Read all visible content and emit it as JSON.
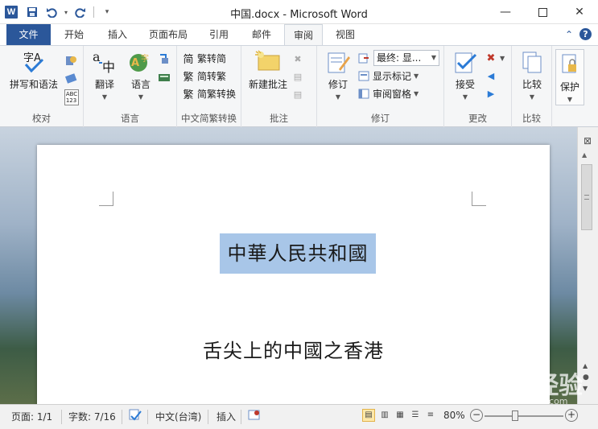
{
  "app": {
    "app_icon_letter": "W",
    "title": "中国.docx - Microsoft Word"
  },
  "qat": {
    "save_icon": "save-icon",
    "undo_icon": "undo-icon",
    "redo_icon": "redo-icon"
  },
  "tabs": [
    {
      "label": "文件"
    },
    {
      "label": "开始"
    },
    {
      "label": "插入"
    },
    {
      "label": "页面布局"
    },
    {
      "label": "引用"
    },
    {
      "label": "邮件"
    },
    {
      "label": "审阅"
    },
    {
      "label": "视图"
    }
  ],
  "active_tab": "审阅",
  "ribbon": {
    "groups": {
      "proofing": {
        "label": "校对",
        "spell": "拼写和语法"
      },
      "language": {
        "label": "语言",
        "translate": "翻译",
        "language": "语言"
      },
      "chinese_conversion": {
        "label": "中文简繁转换",
        "to_simplified": "繁转简",
        "to_traditional": "简转繁",
        "convert": "简繁转换"
      },
      "comments": {
        "label": "批注",
        "new_comment": "新建批注"
      },
      "tracking": {
        "label": "修订",
        "track_changes": "修订",
        "display_value": "最终: 显...",
        "show_markup": "显示标记",
        "reviewing_pane": "审阅窗格"
      },
      "changes": {
        "label": "更改",
        "accept": "接受"
      },
      "compare": {
        "label": "比较",
        "compare": "比较"
      },
      "protect": {
        "label": "",
        "protect": "保护"
      }
    }
  },
  "document": {
    "line1": "中華人民共和國",
    "line2": "舌尖上的中國之香港"
  },
  "status": {
    "page": "页面: 1/1",
    "words": "字数: 7/16",
    "language": "中文(台湾)",
    "mode": "插入",
    "zoom": "80%"
  },
  "watermark": {
    "text": "Baidu经验",
    "sub": "jingyan.baidu.com"
  }
}
